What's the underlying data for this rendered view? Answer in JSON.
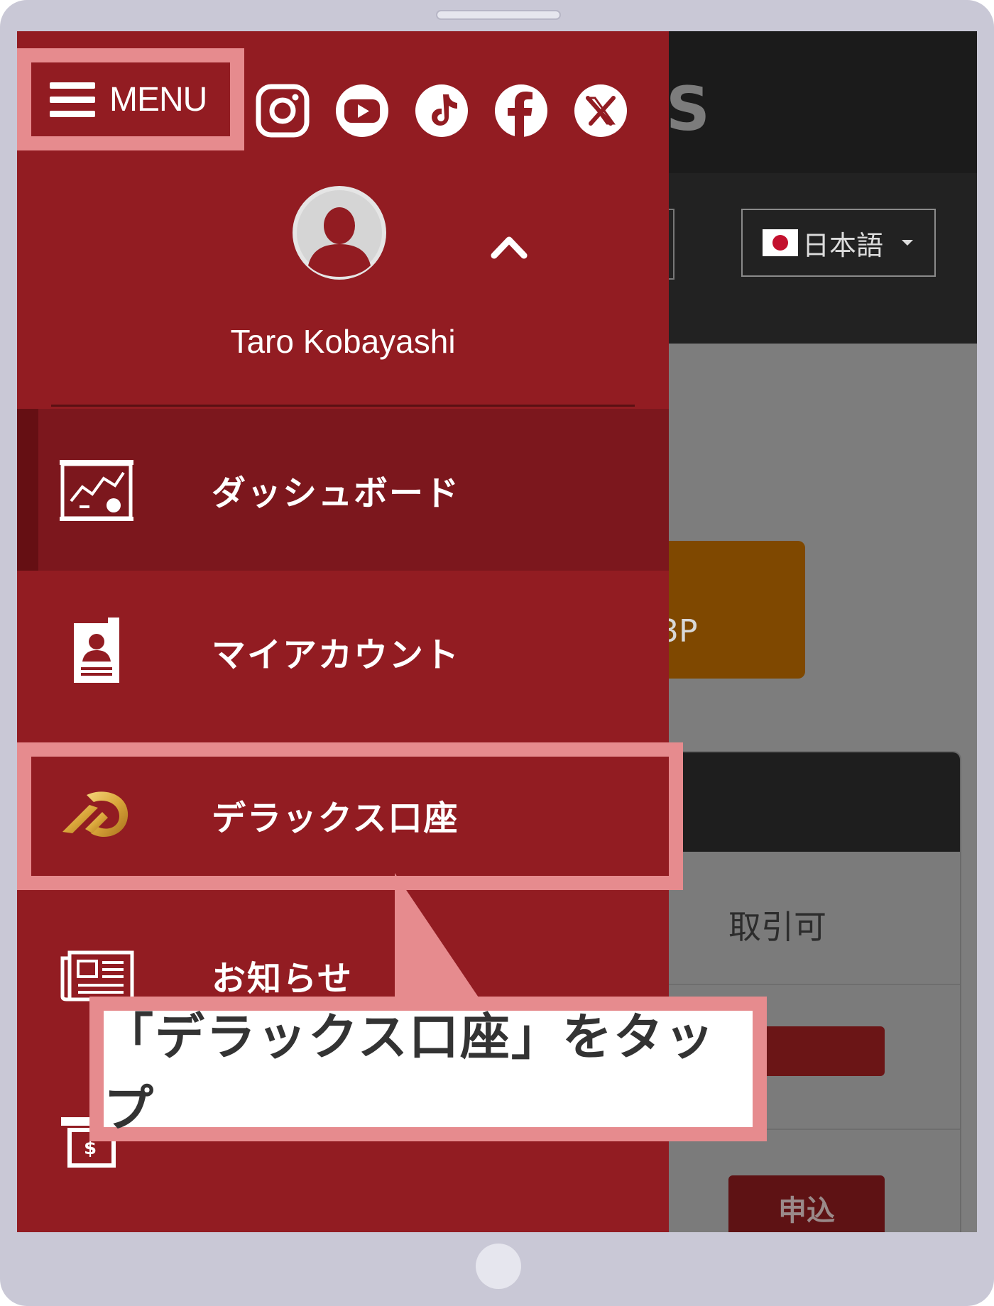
{
  "header": {
    "menu_label": "MENU",
    "logo_fragment": "S",
    "language": {
      "selected": "日本語",
      "flag": "japan-flag"
    }
  },
  "social": [
    "instagram",
    "youtube",
    "tiktok",
    "facebook",
    "x"
  ],
  "profile": {
    "name": "Taro Kobayashi"
  },
  "nav": {
    "items": [
      {
        "label": "ダッシュボード",
        "icon": "dashboard-chart-icon",
        "active": true
      },
      {
        "label": "マイアカウント",
        "icon": "id-card-icon",
        "active": false
      },
      {
        "label": "デラックス口座",
        "icon": "deluxe-logo-icon",
        "active": false,
        "highlighted": true
      },
      {
        "label": "お知らせ",
        "icon": "newspaper-icon",
        "active": false
      },
      {
        "label": "",
        "icon": "money-icon",
        "active": false
      }
    ]
  },
  "background": {
    "orange_card_text": "3P",
    "trade_status": "取引可",
    "apply_button": "申込"
  },
  "callout": {
    "text": "「デラックス口座」をタップ"
  },
  "colors": {
    "drawer": "#921c22",
    "active_item": "#7c171d",
    "highlight": "#e68b8e",
    "device_frame": "#c9c8d6"
  }
}
